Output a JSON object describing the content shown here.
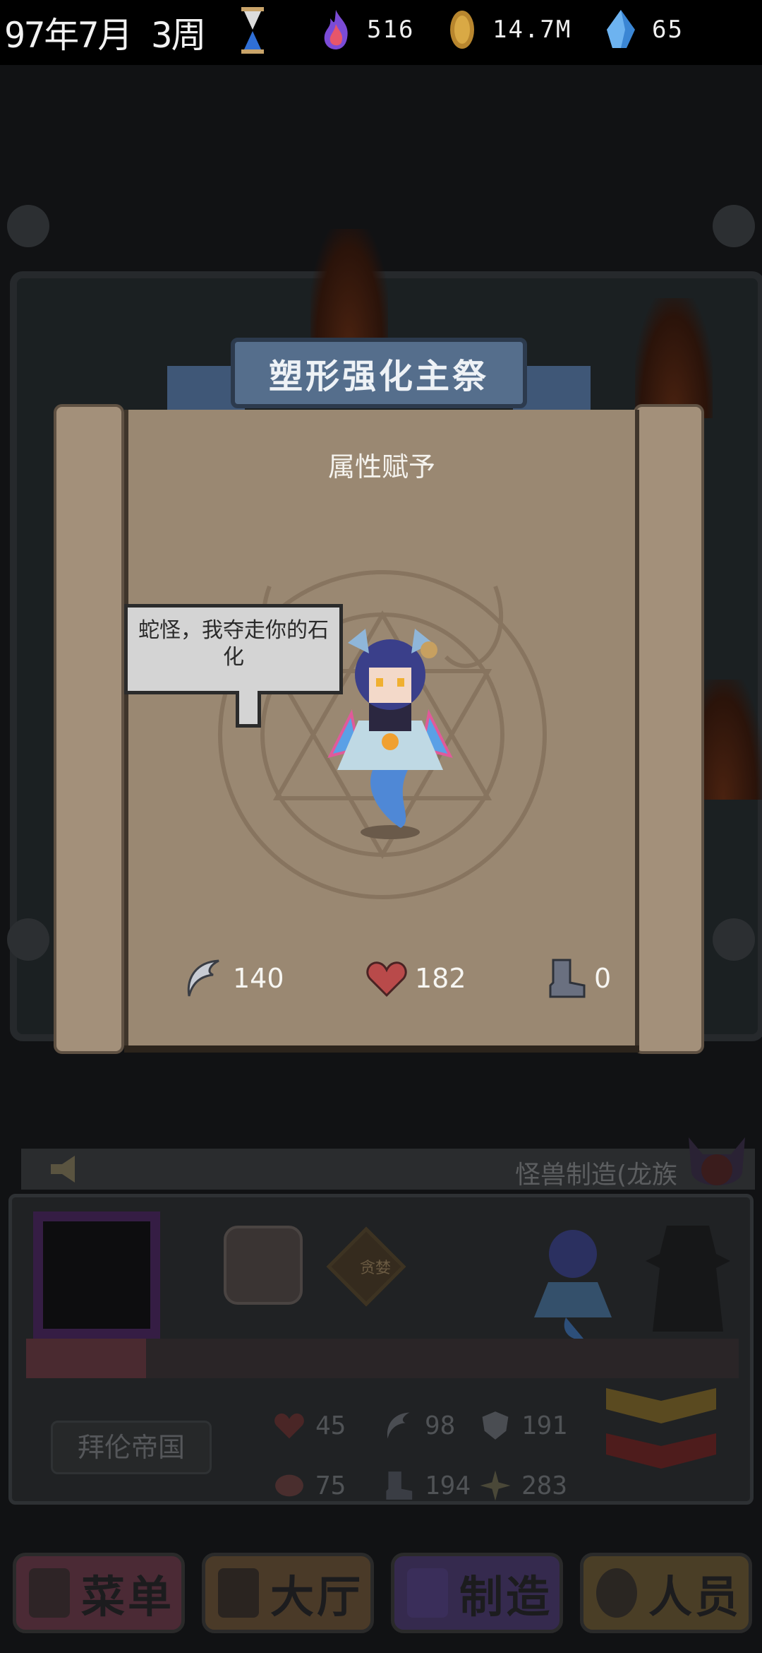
{
  "status_bar": {
    "date": "97年7月 3周",
    "resources": [
      {
        "icon": "purple-flame-icon",
        "value": "516"
      },
      {
        "icon": "gold-coin-icon",
        "value": "14.7M"
      },
      {
        "icon": "blue-crystal-icon",
        "value": "65"
      }
    ]
  },
  "dialog": {
    "title": "塑形强化主祭",
    "subtitle": "属性赋予",
    "speech": "蛇怪，我夺走你的石化",
    "stats": [
      {
        "icon": "claw-icon",
        "value": "140"
      },
      {
        "icon": "heart-icon",
        "value": "182"
      },
      {
        "icon": "boot-icon",
        "value": "0"
      }
    ]
  },
  "craft_panel": {
    "title": "怪兽制造(龙族",
    "tag": "贪婪",
    "empire": "拜伦帝国",
    "stats": [
      {
        "icon": "heart-icon",
        "value": "45"
      },
      {
        "icon": "claw-icon",
        "value": "98"
      },
      {
        "icon": "shield-icon",
        "value": "191"
      },
      {
        "icon": "brain-icon",
        "value": "75"
      },
      {
        "icon": "boot-icon",
        "value": "194"
      },
      {
        "icon": "sparkle-icon",
        "value": "283"
      }
    ]
  },
  "nav": [
    {
      "label": "菜单",
      "icon": "phone-icon",
      "color": "#b5577c"
    },
    {
      "label": "大厅",
      "icon": "door-icon",
      "color": "#b08659"
    },
    {
      "label": "制造",
      "icon": "paw-icon",
      "color": "#6e5aa8"
    },
    {
      "label": "人员",
      "icon": "person-icon",
      "color": "#b3965a"
    }
  ]
}
